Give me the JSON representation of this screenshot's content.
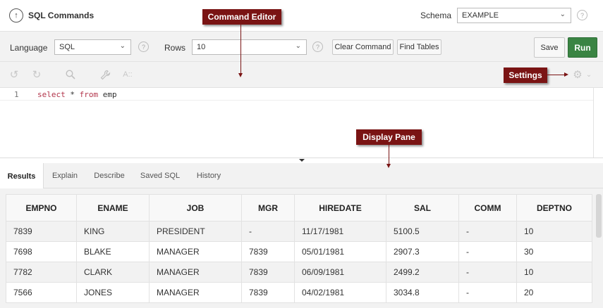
{
  "header": {
    "app_title": "SQL Commands",
    "app_icon": "circle-up-arrow-icon",
    "schema_label": "Schema",
    "schema_value": "EXAMPLE",
    "help_glyph": "?"
  },
  "toolbar": {
    "language_label": "Language",
    "language_value": "SQL",
    "rows_label": "Rows",
    "rows_value": "10",
    "clear_command_label": "Clear Command",
    "find_tables_label": "Find Tables",
    "save_label": "Save",
    "run_label": "Run"
  },
  "editor_icons": [
    "undo-icon",
    "redo-icon",
    "search-icon",
    "wrench-icon",
    "font-size-icon",
    "gear-icon"
  ],
  "editor": {
    "line_number": "1",
    "code_keyword_1": "select",
    "code_plain_1": " * ",
    "code_keyword_2": "from",
    "code_plain_2": " emp"
  },
  "tabs": [
    {
      "label": "Results",
      "active": true
    },
    {
      "label": "Explain",
      "active": false
    },
    {
      "label": "Describe",
      "active": false
    },
    {
      "label": "Saved SQL",
      "active": false
    },
    {
      "label": "History",
      "active": false
    }
  ],
  "results": {
    "columns": [
      "EMPNO",
      "ENAME",
      "JOB",
      "MGR",
      "HIREDATE",
      "SAL",
      "COMM",
      "DEPTNO"
    ],
    "rows": [
      [
        "7839",
        "KING",
        "PRESIDENT",
        "-",
        "11/17/1981",
        "5100.5",
        "-",
        "10"
      ],
      [
        "7698",
        "BLAKE",
        "MANAGER",
        "7839",
        "05/01/1981",
        "2907.3",
        "-",
        "30"
      ],
      [
        "7782",
        "CLARK",
        "MANAGER",
        "7839",
        "06/09/1981",
        "2499.2",
        "-",
        "10"
      ],
      [
        "7566",
        "JONES",
        "MANAGER",
        "7839",
        "04/02/1981",
        "3034.8",
        "-",
        "20"
      ]
    ]
  },
  "callouts": {
    "command_editor": "Command Editor",
    "settings": "Settings",
    "display_pane": "Display Pane"
  },
  "colors": {
    "run_button": "#3a8443",
    "callout_bg": "#7a1414",
    "keyword": "#b2344a"
  }
}
